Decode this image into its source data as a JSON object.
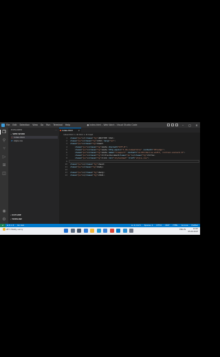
{
  "titlebar": {
    "menu": [
      "File",
      "Edit",
      "Selection",
      "View",
      "Go",
      "Run",
      "Terminal",
      "Help"
    ],
    "title": "● index.html - Web Work - Visual Studio Code"
  },
  "activity_bar": [
    "files-icon",
    "search-icon",
    "source-control-icon",
    "run-debug-icon",
    "extensions-icon",
    "remote-icon",
    "account-icon",
    "settings-icon"
  ],
  "sidebar": {
    "header": "EXPLORER",
    "section": "WEB WORK",
    "files": [
      {
        "name": "index.html",
        "icon": "html-file-icon"
      },
      {
        "name": "style.css",
        "icon": "css-file-icon"
      }
    ],
    "outline": "OUTLINE",
    "timeline": "TIMELINE"
  },
  "editor": {
    "tab": "index.html",
    "breadcrumb": "index.html > ♦ html > ♦ head",
    "lines": [
      {
        "n": "1",
        "text": "<!DOCTYPE html>"
      },
      {
        "n": "2",
        "text": "<html lang=\"en\">"
      },
      {
        "n": "3",
        "text": "<head>"
      },
      {
        "n": "4",
        "text": "    <meta charset=\"UTF-8\">"
      },
      {
        "n": "5",
        "text": "    <meta http-equiv=\"X-UA-Compatible\" content=\"IE=edge\">"
      },
      {
        "n": "6",
        "text": "    <meta name=\"viewport\" content=\"width=device-width, initial-scale=1.0\">"
      },
      {
        "n": "7",
        "text": "    <title>Document</title>"
      },
      {
        "n": "8",
        "text": "    <link rel=\"stylesheet\" href=\"style.css\">"
      },
      {
        "n": "9",
        "text": ""
      },
      {
        "n": "10",
        "text": "</head>"
      },
      {
        "n": "11",
        "text": "<body>"
      },
      {
        "n": "12",
        "text": ""
      },
      {
        "n": "13",
        "text": "</body>"
      },
      {
        "n": "14",
        "text": "</html>"
      }
    ]
  },
  "statusbar": {
    "left": [
      "⊗ 0 ⚠ 0",
      "Go Live"
    ],
    "right": [
      "Ln 9, Col 5",
      "Spaces: 4",
      "UTF-8",
      "CRLF",
      "HTML",
      "Go Live",
      "Prettier"
    ]
  },
  "taskbar": {
    "weather": "28°C Mostly sunny",
    "app_icons": [
      {
        "name": "start-icon",
        "color": "#1f6fd1"
      },
      {
        "name": "search-taskbar-icon",
        "color": "#5b6b80"
      },
      {
        "name": "task-view-icon",
        "color": "#44546a"
      },
      {
        "name": "widgets-icon",
        "color": "#2d7ad6"
      },
      {
        "name": "file-explorer-icon",
        "color": "#f0b73a"
      },
      {
        "name": "edge-icon",
        "color": "#1e9bd7"
      },
      {
        "name": "store-icon",
        "color": "#3b82d6"
      },
      {
        "name": "chrome-icon",
        "color": "#db4437"
      },
      {
        "name": "vscode-icon",
        "color": "#007acc"
      },
      {
        "name": "photos-icon",
        "color": "#2a8fd3"
      },
      {
        "name": "settings-taskbar-icon",
        "color": "#6b7280"
      }
    ],
    "lang": "ENG IN",
    "time": "14:02",
    "date": "05-06-2023"
  }
}
